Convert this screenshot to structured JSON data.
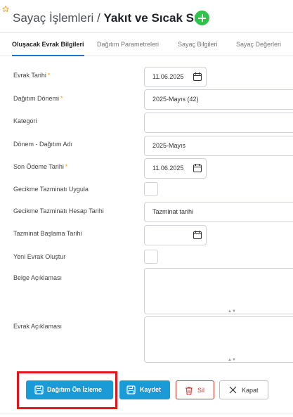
{
  "header": {
    "title": "Sayaç İşlemleri",
    "separator": " / ",
    "subtitle": "Yakıt ve Sıcak Su"
  },
  "tabs": [
    {
      "label": "Oluşacak Evrak Bilgileri",
      "active": true
    },
    {
      "label": "Dağıtım Parametreleri",
      "active": false
    },
    {
      "label": "Sayaç Bilgileri",
      "active": false
    },
    {
      "label": "Sayaç Değerleri",
      "active": false
    }
  ],
  "form": {
    "evrak_tarihi": {
      "label": "Evrak Tarihi",
      "required_mark": "*",
      "value": "11.06.2025"
    },
    "dagitim_donemi": {
      "label": "Dağıtım Dönemi",
      "required_mark": "*",
      "value": "2025-Mayıs (42)"
    },
    "kategori": {
      "label": "Kategori",
      "value": ""
    },
    "donem_dagitim_adi": {
      "label": "Dönem - Dağıtım Adı",
      "value": "2025-Mayıs"
    },
    "son_odeme_tarihi": {
      "label": "Son Ödeme Tarihi",
      "required_mark": "*",
      "value": "11.06.2025"
    },
    "gecikme_tazminati_uygula": {
      "label": "Gecikme Tazminatı Uygula",
      "checked": false
    },
    "gecikme_tazminati_hesap_tarihi": {
      "label": "Gecikme Tazminatı Hesap Tarihi",
      "value": "Tazminat tarihi"
    },
    "tazminat_baslama_tarihi": {
      "label": "Tazminat Başlama Tarihi",
      "value": ""
    },
    "yeni_evrak_olustur": {
      "label": "Yeni Evrak Oluştur",
      "checked": false
    },
    "belge_aciklamasi": {
      "label": "Belge Açıklaması",
      "value": ""
    },
    "evrak_aciklamasi": {
      "label": "Evrak Açıklaması",
      "value": ""
    }
  },
  "actions": {
    "preview_label": "Dağıtım Ön İzleme",
    "save_label": "Kaydet",
    "delete_label": "Sil",
    "close_label": "Kapat"
  },
  "colors": {
    "primary": "#1a9ad6",
    "add_button": "#2ec44a",
    "active_tab_underline": "#1b74c9",
    "required": "#f0a500",
    "danger": "#c0392b",
    "highlight": "#e3151b"
  },
  "icons": {
    "pin": "pin-icon",
    "add": "plus-circle-icon",
    "calendar": "calendar-icon",
    "save": "floppy-disk-icon",
    "delete": "trash-icon",
    "close": "x-icon"
  }
}
